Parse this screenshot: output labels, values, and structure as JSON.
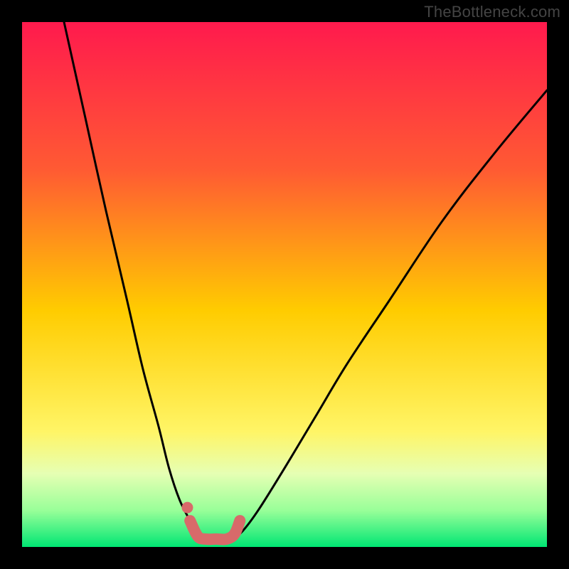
{
  "credit": "TheBottleneck.com",
  "chart_data": {
    "type": "line",
    "title": "",
    "xlabel": "",
    "ylabel": "",
    "ylim": [
      0,
      100
    ],
    "xlim": [
      0,
      100
    ],
    "gradient_stops": [
      {
        "offset": 0,
        "color": "#ff1a4d"
      },
      {
        "offset": 28,
        "color": "#ff5a33"
      },
      {
        "offset": 55,
        "color": "#ffcc00"
      },
      {
        "offset": 78,
        "color": "#fff566"
      },
      {
        "offset": 86,
        "color": "#e6ffb3"
      },
      {
        "offset": 93,
        "color": "#99ff99"
      },
      {
        "offset": 100,
        "color": "#00e673"
      }
    ],
    "series": [
      {
        "name": "left-curve",
        "x": [
          8,
          12,
          16,
          20,
          23,
          26,
          28,
          30,
          32,
          33,
          34,
          35
        ],
        "values": [
          100,
          82,
          64,
          47,
          34,
          23,
          15,
          9,
          5,
          3,
          2,
          1.5
        ]
      },
      {
        "name": "right-curve",
        "x": [
          40,
          42,
          45,
          50,
          56,
          62,
          70,
          80,
          90,
          100
        ],
        "values": [
          1.5,
          3,
          7,
          15,
          25,
          35,
          47,
          62,
          75,
          87
        ]
      }
    ],
    "well_markers": {
      "color": "#d86a6a",
      "points_x": [
        32,
        33.5,
        35,
        37,
        39,
        40.5,
        41.5
      ],
      "points_y": [
        5,
        2,
        1.5,
        1.5,
        1.5,
        2.5,
        5
      ]
    }
  }
}
